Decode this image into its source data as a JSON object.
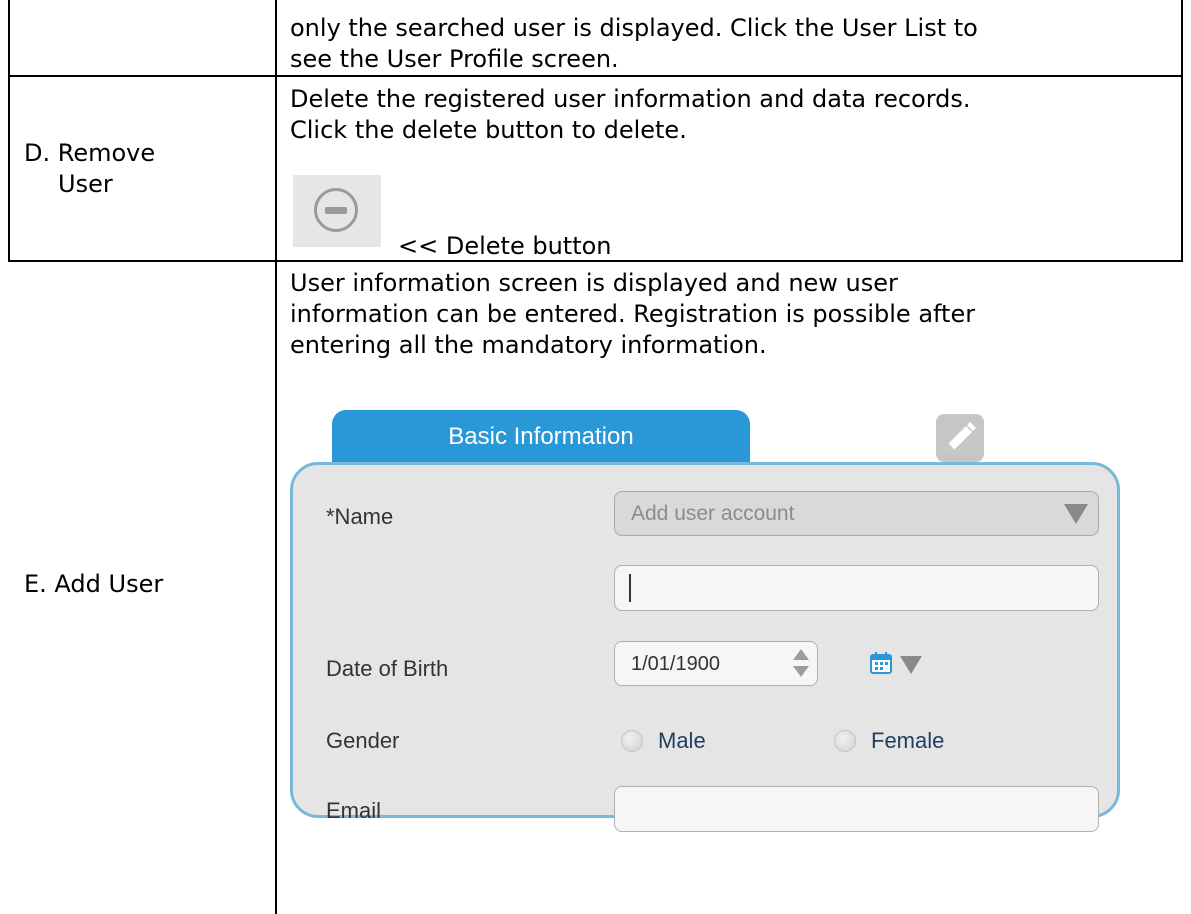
{
  "row_top": {
    "text_line1": "only the searched user is displayed. Click the User List to",
    "text_line2": "see the User Profile screen."
  },
  "row_remove": {
    "label_line1": "D.  Remove",
    "label_line2": "User",
    "text_line1": "Delete the registered user information and data records.",
    "text_line2": "Click the delete button to delete.",
    "icon": "minus-circle-icon",
    "caption": "<< Delete button"
  },
  "row_add": {
    "label": "E.  Add User",
    "text_line1": "User information screen is displayed and new user",
    "text_line2": "information can be entered. Registration is possible after",
    "text_line3": "entering all the mandatory information."
  },
  "form": {
    "tab_label": "Basic Information",
    "edit_icon": "pencil-icon",
    "accent_color": "#2a98d6",
    "name_label": "*Name",
    "account_select_value": "Add user account",
    "name_input_value": "",
    "dob_label": "Date of Birth",
    "dob_value": "1/01/1900",
    "calendar_icon": "calendar-icon",
    "gender_label": "Gender",
    "gender_options": [
      "Male",
      "Female"
    ],
    "email_label": "Email",
    "email_value": ""
  }
}
